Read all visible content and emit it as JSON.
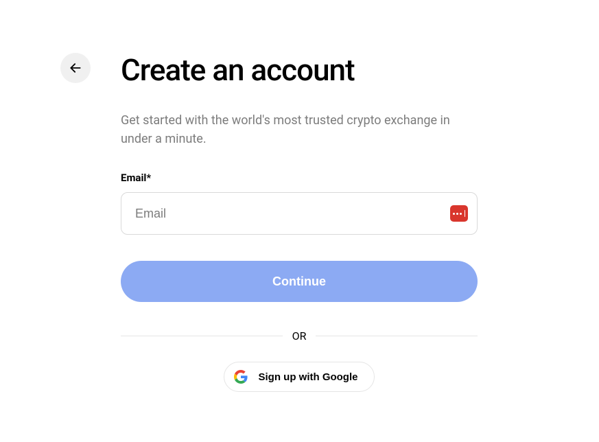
{
  "title": "Create an account",
  "subtitle": "Get started with the world's most trusted crypto exchange in under a minute.",
  "email": {
    "label": "Email*",
    "placeholder": "Email",
    "value": ""
  },
  "continue_label": "Continue",
  "divider_text": "OR",
  "google_label": "Sign up with Google"
}
